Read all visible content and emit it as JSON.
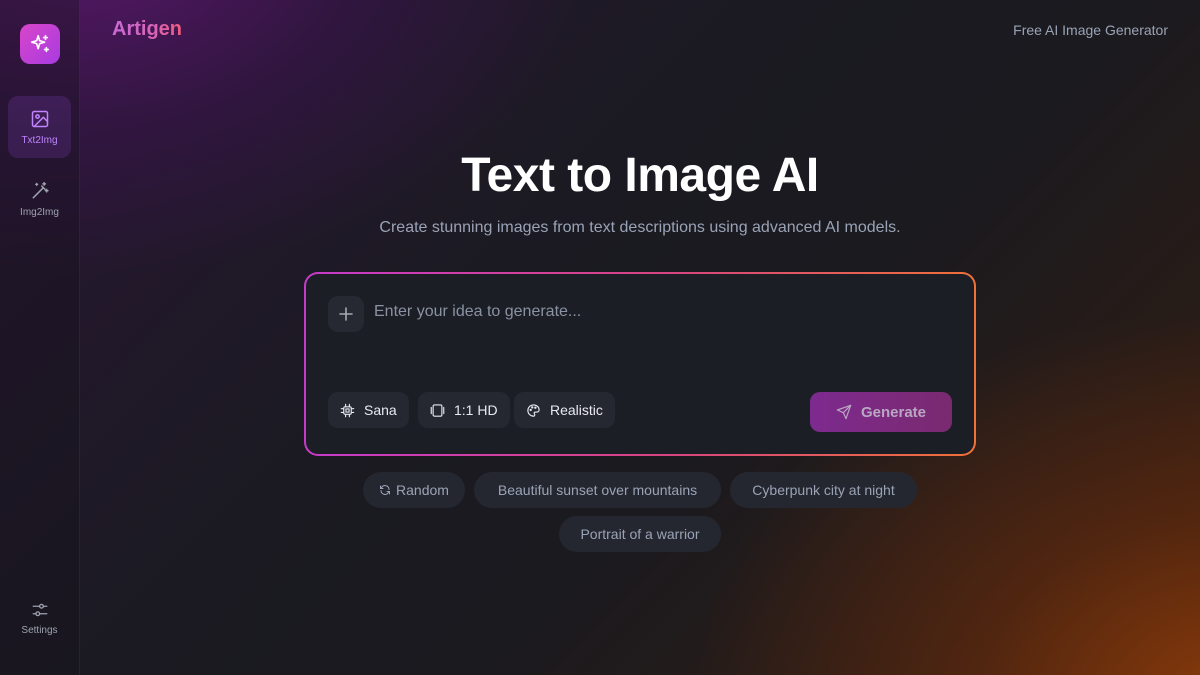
{
  "brand": {
    "name": "Artigen",
    "tagline": "Free AI Image Generator"
  },
  "sidebar": {
    "items": [
      {
        "label": "Txt2Img",
        "icon": "image-icon",
        "active": true
      },
      {
        "label": "Img2Img",
        "icon": "magic-wand-icon",
        "active": false
      }
    ],
    "settings_label": "Settings"
  },
  "hero": {
    "title": "Text to Image AI",
    "subtitle": "Create stunning images from text descriptions using advanced AI models."
  },
  "prompt": {
    "placeholder": "Enter your idea to generate...",
    "value": ""
  },
  "options": {
    "model": "Sana",
    "size": "1:1 HD",
    "style": "Realistic"
  },
  "generate_label": "Generate",
  "suggestions": {
    "random_label": "Random",
    "items": [
      "Beautiful sunset over mountains",
      "Cyberpunk city at night",
      "Portrait of a warrior"
    ]
  },
  "colors": {
    "accent_start": "#c73ac9",
    "accent_end": "#f0713a",
    "background": "#17161c",
    "card": "#1c1e25"
  }
}
